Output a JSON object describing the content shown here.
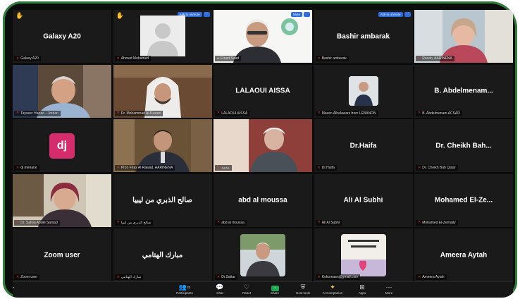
{
  "meeting": {
    "ask_to_unmute": "Ask to unmute",
    "mute": "Mute",
    "more_dots": "···",
    "tiles": [
      {
        "title": "Galaxy A20",
        "label": "Galaxy A20",
        "hand": true
      },
      {
        "title": "",
        "label": "Ahmed Mohamed",
        "hand": true,
        "unmute": true,
        "avatar": "default-person"
      },
      {
        "title": "",
        "label": "Emad Saad",
        "video": true,
        "mute_button": true
      },
      {
        "title": "Bashir  ambarak",
        "label": "Bashir  ambarak",
        "unmute": true
      },
      {
        "title": "",
        "label": "Rasah, AARINENA",
        "video": true
      },
      {
        "title": "",
        "label": "Tayseer Hartan - Jordan",
        "video": true
      },
      {
        "title": "",
        "label": "Dr. Mohammad Al-Kuwari",
        "video": true
      },
      {
        "title": "LALAOUI AISSA",
        "label": "LALAOUI AISSA"
      },
      {
        "title": "",
        "label": "Mazen Alhalawani from LEBANON",
        "photo": true
      },
      {
        "title": "B. Abdelmenam...",
        "label": "B. Abdelmenam ACSAD"
      },
      {
        "title": "",
        "label": "dj meriane",
        "avatar_text": "dj"
      },
      {
        "title": "",
        "label": "Prof. Firas Al Rawad, AARINENA",
        "video": true,
        "speaking": true
      },
      {
        "title": "",
        "label": "محمد",
        "video": true
      },
      {
        "title": "Dr.Haifa",
        "label": "Dr.Haifa"
      },
      {
        "title": "Dr. Cheikh Bah...",
        "label": "Dr. Cheikh Bah   Qatar"
      },
      {
        "title": "",
        "label": "Dr. Salwa Abdel Samad",
        "video": true
      },
      {
        "title": "صالح الذبري من ليبيا",
        "label": "صالح الذبري من ليبيا"
      },
      {
        "title": "abd al moussa",
        "label": "abd al moussa"
      },
      {
        "title": "Ali Al Subhi",
        "label": "Ali Al Subhi"
      },
      {
        "title": "Mohamed  El-Ze...",
        "label": "Mohamed El-Zemaity"
      },
      {
        "title": "Zoom user",
        "label": "Zoom user"
      },
      {
        "title": "مبارك الهتامي",
        "label": "مبارك الهتامي"
      },
      {
        "title": "",
        "label": "Dr.Sattar",
        "photo": true
      },
      {
        "title": "",
        "label": "Kokomaan@gmail.com",
        "photo": true
      },
      {
        "title": "Ameera Aytah",
        "label": "Ameera Aytah"
      }
    ]
  },
  "toolbar": {
    "participants_count": "33",
    "items": [
      {
        "key": "participants",
        "label": "Participants",
        "icon": "participants-icon"
      },
      {
        "key": "chat",
        "label": "Chat",
        "icon": "chat-icon"
      },
      {
        "key": "react",
        "label": "React",
        "icon": "heart-icon"
      },
      {
        "key": "share",
        "label": "Share",
        "icon": "share-screen-icon"
      },
      {
        "key": "host_tools",
        "label": "Host tools",
        "icon": "shield-icon"
      },
      {
        "key": "ai",
        "label": "AI Companion",
        "icon": "sparkle-icon"
      },
      {
        "key": "apps",
        "label": "Apps",
        "icon": "apps-icon"
      },
      {
        "key": "more",
        "label": "More",
        "icon": "more-icon"
      }
    ]
  },
  "colors": {
    "frame_border": "#2f7d3a",
    "speaking_border": "#33c94f",
    "ask_button": "#2d6cdf",
    "mic_muted": "#e23b3b",
    "share_green": "#1ea84f",
    "dj_avatar": "#d52d6b"
  }
}
